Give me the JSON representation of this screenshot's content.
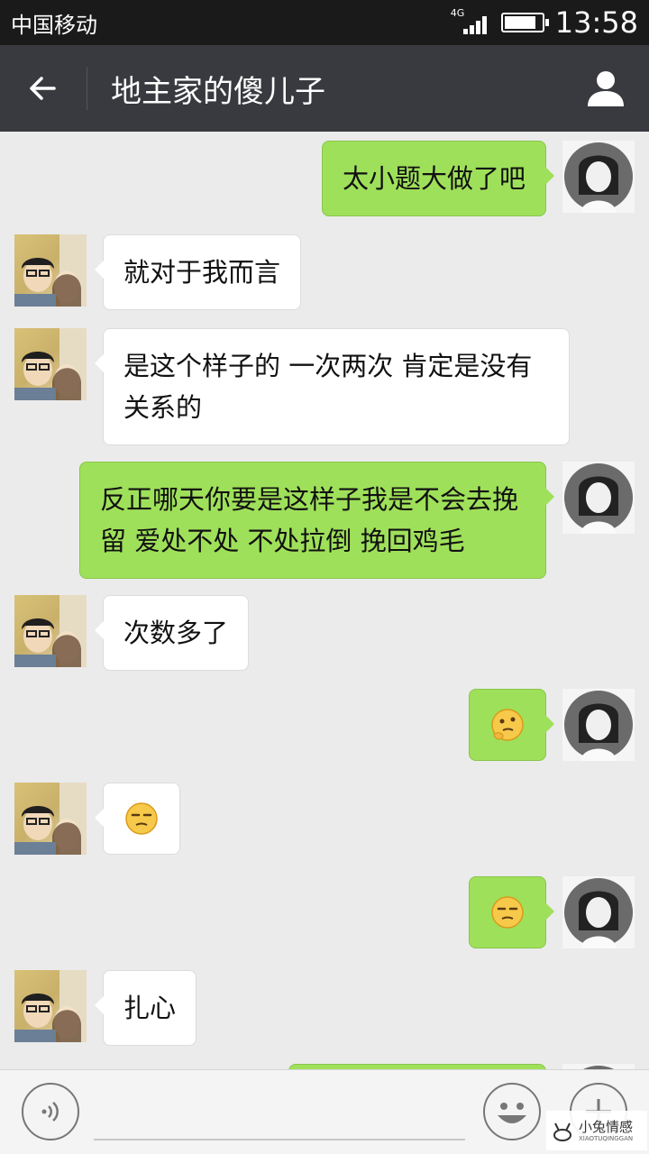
{
  "status_bar": {
    "carrier": "中国移动",
    "network": "4G",
    "time": "13:58",
    "battery_level": 0.85
  },
  "header": {
    "title": "地主家的傻儿子",
    "back_icon": "back-arrow-icon",
    "profile_icon": "person-icon"
  },
  "messages": [
    {
      "side": "right",
      "text": "太小题大做了吧"
    },
    {
      "side": "left",
      "text": "就对于我而言"
    },
    {
      "side": "left",
      "text": "是这个样子的 一次两次 肯定是没有关系的"
    },
    {
      "side": "right",
      "text": "反正哪天你要是这样子我是不会去挽留 爱处不处 不处拉倒 挽回鸡毛"
    },
    {
      "side": "left",
      "text": "次数多了"
    },
    {
      "side": "right",
      "emoji": "thinking-face"
    },
    {
      "side": "left",
      "emoji": "unamused-face"
    },
    {
      "side": "right",
      "emoji": "unamused-face"
    },
    {
      "side": "left",
      "text": "扎心"
    }
  ],
  "input_bar": {
    "voice_icon": "voice-icon",
    "emoji_icon": "emoji-icon",
    "plus_icon": "plus-icon"
  },
  "watermark": {
    "text": "小兔情感",
    "sub": "XIAOTUQINGGAN"
  },
  "colors": {
    "sent_bubble": "#9fe05a",
    "received_bubble": "#ffffff",
    "chat_background": "#ebebeb",
    "title_bar": "#393a3f"
  }
}
